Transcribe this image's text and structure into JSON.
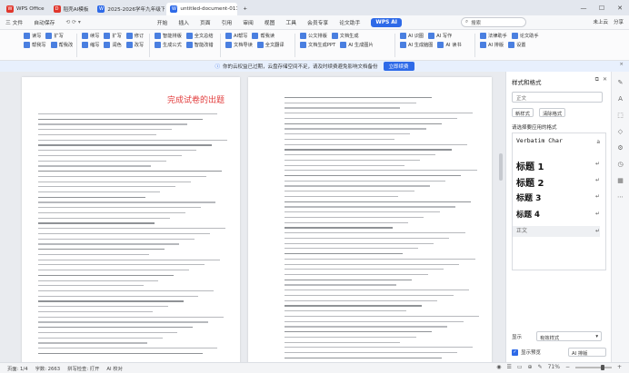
{
  "titlebar": {
    "tabs": [
      {
        "label": "WPS Office",
        "color": "#e0362c",
        "glyph": "W"
      },
      {
        "label": "稻壳AI模板",
        "color": "#e0362c",
        "glyph": "D"
      },
      {
        "label": "2025-2026学年九年级下册数学",
        "color": "#2e6ae8",
        "glyph": "W"
      },
      {
        "label": "untitled-document-0115",
        "color": "#2e6ae8",
        "glyph": "W"
      }
    ],
    "add_tab": "+"
  },
  "menubar": {
    "file_label": "三 文件",
    "autosave_label": "自动保存",
    "items": [
      "开始",
      "插入",
      "页面",
      "引用",
      "审阅",
      "视图",
      "工具",
      "会员专享",
      "论文助手"
    ],
    "wps_ai_label": "WPS AI",
    "search_placeholder": "搜索",
    "user_label": "未上云",
    "share_label": "分享"
  },
  "ribbon": {
    "groups": [
      {
        "row1": [
          "读写",
          "扩写"
        ],
        "row2": [
          "帮我写",
          "帮我改"
        ]
      },
      {
        "row1": [
          "续写",
          "扩写",
          "修订"
        ],
        "row2": [
          "缩写",
          "润色",
          "改写"
        ]
      },
      {
        "row1": [
          "智能排版",
          "全文总结"
        ],
        "row2": [
          "生成公式",
          "智能改错"
        ]
      },
      {
        "row1": [
          "AI帮写",
          "帮我读"
        ],
        "row2": [
          "文档导读",
          "全文翻译"
        ]
      },
      {
        "row1": [
          "公文排版",
          "文档生成"
        ],
        "row2": [
          "文档生成PPT",
          "AI 生成图片"
        ]
      },
      {
        "row1": [
          "AI 识图",
          "AI 写作"
        ],
        "row2": [
          "AI 生成脑图",
          "AI 读书"
        ]
      },
      {
        "row1": [
          "法律助手",
          "论文助手"
        ],
        "row2": [
          "AI 排版",
          "设置"
        ]
      }
    ]
  },
  "notification": {
    "text": "你的云权益已过期，云盘存储空间不足，请及时续费避免影响文档备份",
    "button": "立即续费",
    "close": "×"
  },
  "document": {
    "title": "完成试卷的出题"
  },
  "style_panel": {
    "title": "样式和格式",
    "current_style": "正文",
    "new_button": "新样式",
    "clear_button": "清除格式",
    "list_label": "请选择要应用的格式",
    "styles": [
      {
        "label": "Verbatim Char",
        "mark": "a"
      },
      {
        "label": "标题 1",
        "mark": "↵"
      },
      {
        "label": "标题 2",
        "mark": "↵"
      },
      {
        "label": "标题 3",
        "mark": "↵"
      },
      {
        "label": "标题 4",
        "mark": "↵"
      },
      {
        "label": "正文",
        "mark": "↵"
      }
    ],
    "show_label": "显示",
    "show_value": "有效样式",
    "preview_label": "显示预览",
    "ai_label": "AI 排版"
  },
  "statusbar": {
    "page": "页面: 1/4",
    "words": "字数: 2663",
    "spell": "拼写检查: 打开",
    "ai": "AI 校对",
    "zoom": "71%"
  }
}
